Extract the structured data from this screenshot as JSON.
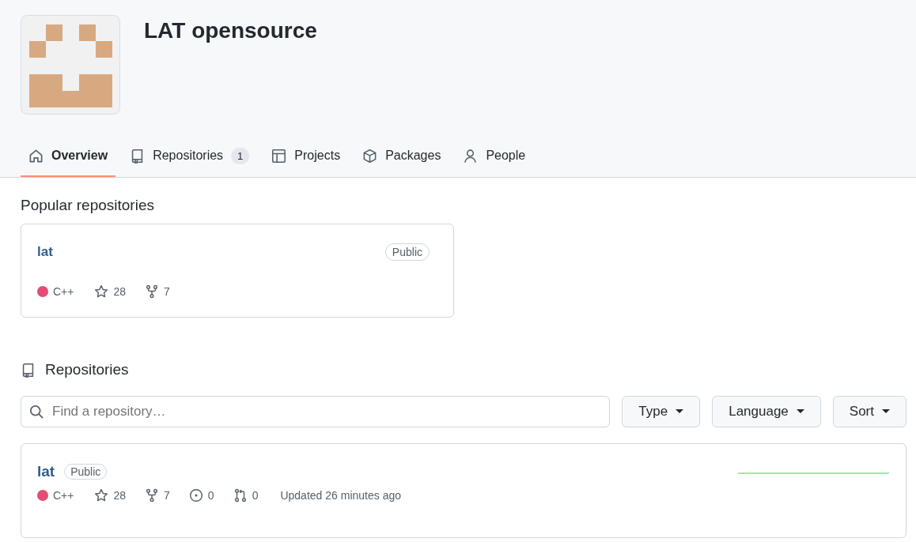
{
  "org": {
    "name": "LAT opensource"
  },
  "tabs": [
    {
      "label": "Overview",
      "kind": "home",
      "selected": true
    },
    {
      "label": "Repositories",
      "kind": "repo",
      "count": "1",
      "selected": false
    },
    {
      "label": "Projects",
      "kind": "table",
      "selected": false
    },
    {
      "label": "Packages",
      "kind": "package",
      "selected": false
    },
    {
      "label": "People",
      "kind": "person",
      "selected": false
    }
  ],
  "popular": {
    "heading": "Popular repositories",
    "cards": [
      {
        "name": "lat",
        "visibility": "Public",
        "language": "C++",
        "color": "#e34c76",
        "stars": "28",
        "forks": "7"
      }
    ]
  },
  "repositories": {
    "heading": "Repositories",
    "search": {
      "placeholder": "Find a repository…"
    },
    "filters": [
      "Type",
      "Language",
      "Sort"
    ],
    "rows": [
      {
        "name": "lat",
        "visibility": "Public",
        "language": "C++",
        "color": "#e34c76",
        "stars": "28",
        "forks": "7",
        "issues": "0",
        "pulls": "0",
        "updated": "Updated 26 minutes ago"
      }
    ]
  }
}
